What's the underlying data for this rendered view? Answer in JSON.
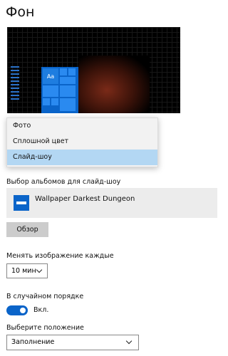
{
  "page": {
    "title": "Фон"
  },
  "background_type_dropdown": {
    "options": [
      "Фото",
      "Сплошной цвет",
      "Слайд-шоу"
    ],
    "selected": "Слайд-шоу"
  },
  "preview": {
    "tile_label": "Aa"
  },
  "slideshow": {
    "albums_label": "Выбор альбомов для слайд-шоу",
    "album_name": "Wallpaper Darkest Dungeon",
    "browse_label": "Обзор"
  },
  "interval": {
    "label": "Менять изображение каждые",
    "value": "10 мин"
  },
  "shuffle": {
    "label": "В случайном порядке",
    "state_label": "Вкл.",
    "on": true
  },
  "fit": {
    "label": "Выберите положение",
    "value": "Заполнение"
  },
  "colors": {
    "accent": "#0a64c9",
    "selected_option": "#b3d7f3"
  },
  "icons": [
    "chevron-down-icon",
    "album-icon"
  ]
}
